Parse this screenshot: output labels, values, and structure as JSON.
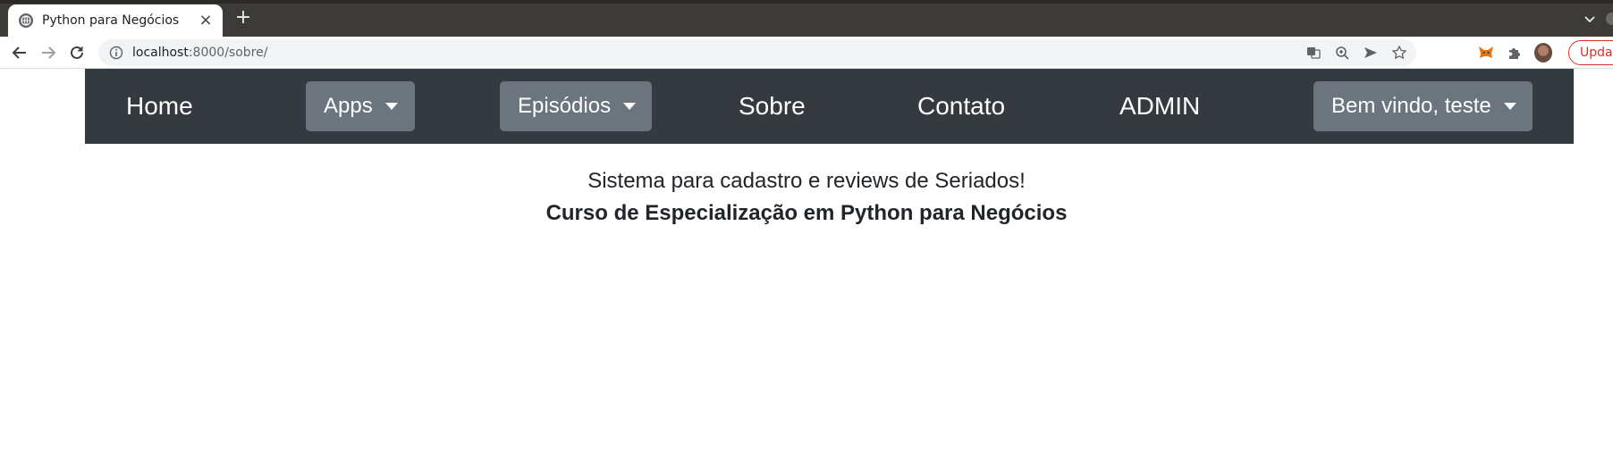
{
  "browser": {
    "tab_title": "Python para Negócios",
    "tab_close": "×",
    "new_tab": "+",
    "url_host": "localhost",
    "url_path": ":8000/sobre/",
    "update_label": "Update"
  },
  "navbar": {
    "home": "Home",
    "apps": "Apps",
    "episodios": "Episódios",
    "sobre": "Sobre",
    "contato": "Contato",
    "admin": "ADMIN",
    "welcome": "Bem vindo, teste"
  },
  "content": {
    "subtitle": "Sistema para cadastro e reviews de Seriados!",
    "course": "Curso de Especialização em Python para Negócios"
  },
  "colors": {
    "navbar_bg": "#343a40",
    "dropdown_bg": "#6c757d",
    "update_red": "#d93025"
  }
}
